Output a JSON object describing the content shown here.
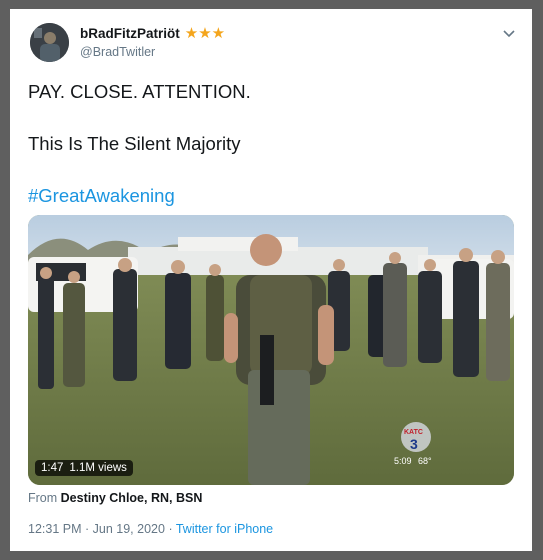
{
  "tweet": {
    "display_name": "bRadFitzPatriöt",
    "badge_stars": "★★★",
    "handle": "@BradTwitler",
    "lines": [
      "PAY. CLOSE. ATTENTION.",
      "This Is The Silent Majority",
      "#GreatAwakening"
    ],
    "hashtag_color": "#1b95e0"
  },
  "media": {
    "duration": "1:47",
    "views": "1.1M views",
    "channel_logo": "KATC",
    "channel_number": "3",
    "overlay_time": "5:09",
    "overlay_temp": "68°"
  },
  "attribution": {
    "prefix": "From",
    "source_name": "Destiny Chloe, RN, BSN"
  },
  "meta": {
    "time": "12:31 PM",
    "separator": "·",
    "date": "Jun 19, 2020",
    "dot": "·",
    "client": "Twitter for iPhone"
  },
  "colors": {
    "star": "#f4a51c",
    "link": "#1b95e0",
    "secondary_text": "#657786"
  }
}
